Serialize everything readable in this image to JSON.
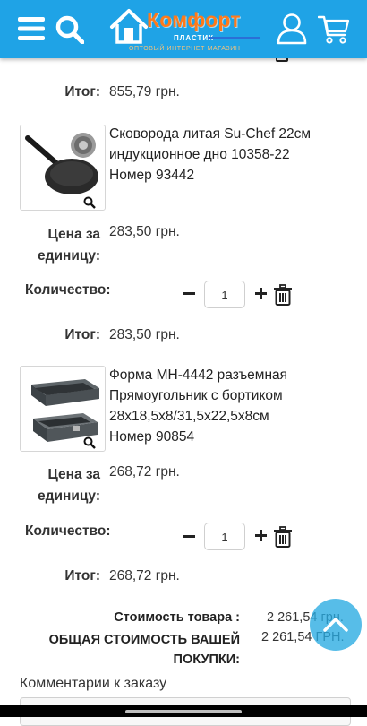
{
  "header": {
    "logo_title": "Комфорт",
    "logo_sub": "ПЛАСТИК",
    "logo_tagline": "ОПТОВЫЙ ИНТЕРНЕТ МАГАЗИН",
    "accent_color": "#1fa3e6",
    "logo_color": "#ff7a1a",
    "icons": [
      "menu-icon",
      "search-icon",
      "user-icon",
      "cart-icon"
    ]
  },
  "labels": {
    "total": "Итог:",
    "unit_price_l1": "Цена за",
    "unit_price_l2": "единицу:",
    "quantity": "Количество:"
  },
  "cart": {
    "previous_item_total": "855,79 грн.",
    "items": [
      {
        "title_l1": "Сковорода литая Su-Chef 22см",
        "title_l2": "индукционное дно 10358-22",
        "number": "Номер 93442",
        "unit_price": "283,50 грн.",
        "quantity": "1",
        "total": "283,50 грн."
      },
      {
        "title_l1": "Форма MH-4442 разъемная",
        "title_l2": "Прямоугольник с бортиком",
        "title_l3": "28x18,5x8/31,5x22,5x8см",
        "number": "Номер 90854",
        "unit_price": "268,72 грн.",
        "quantity": "1",
        "total": "268,72 грн."
      }
    ]
  },
  "summary": {
    "goods_cost_label": "Стоимость товара :",
    "goods_cost_value": "2 261,54 грн.",
    "grand_total_label_l1": "ОБЩАЯ СТОИМОСТЬ ВАШЕЙ",
    "grand_total_label_l2": "ПОКУПКИ:",
    "grand_total_value": "2 261,54 ГРН."
  },
  "comments_label": "Комментарии к заказу"
}
